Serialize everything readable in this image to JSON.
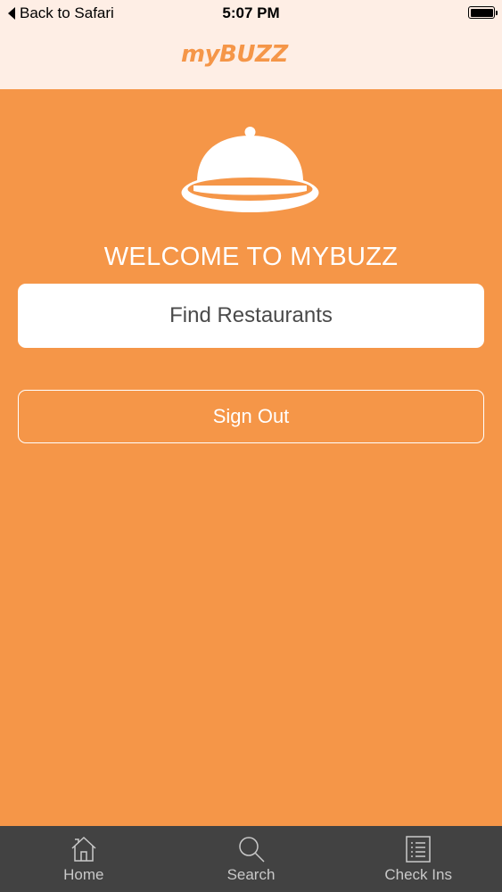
{
  "status_bar": {
    "back_label": "Back to Safari",
    "time": "5:07 PM"
  },
  "header": {
    "logo_text": "myBUZZ"
  },
  "main": {
    "welcome_text": "WELCOME TO MYBUZZ",
    "find_button_label": "Find Restaurants",
    "signout_button_label": "Sign Out"
  },
  "tab_bar": {
    "tabs": [
      {
        "label": "Home",
        "icon": "home-icon"
      },
      {
        "label": "Search",
        "icon": "search-icon"
      },
      {
        "label": "Check Ins",
        "icon": "checklist-icon"
      }
    ]
  },
  "colors": {
    "brand_orange": "#F59648",
    "header_bg": "#FEEEE5",
    "tab_bar_bg": "#424242"
  }
}
